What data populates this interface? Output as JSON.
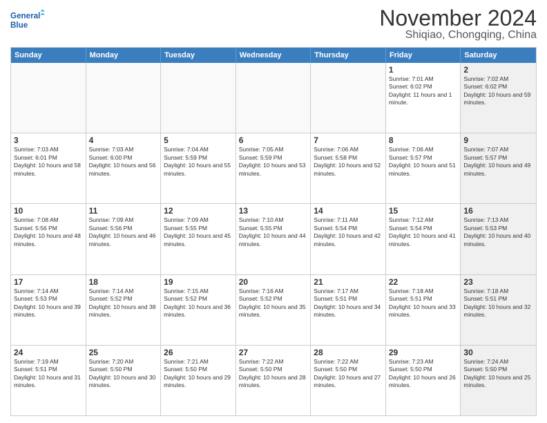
{
  "header": {
    "logo_line1": "General",
    "logo_line2": "Blue",
    "month": "November 2024",
    "location": "Shiqiao, Chongqing, China"
  },
  "days_of_week": [
    "Sunday",
    "Monday",
    "Tuesday",
    "Wednesday",
    "Thursday",
    "Friday",
    "Saturday"
  ],
  "weeks": [
    [
      {
        "day": "",
        "sunrise": "",
        "sunset": "",
        "daylight": "",
        "empty": true
      },
      {
        "day": "",
        "sunrise": "",
        "sunset": "",
        "daylight": "",
        "empty": true
      },
      {
        "day": "",
        "sunrise": "",
        "sunset": "",
        "daylight": "",
        "empty": true
      },
      {
        "day": "",
        "sunrise": "",
        "sunset": "",
        "daylight": "",
        "empty": true
      },
      {
        "day": "",
        "sunrise": "",
        "sunset": "",
        "daylight": "",
        "empty": true
      },
      {
        "day": "1",
        "sunrise": "Sunrise: 7:01 AM",
        "sunset": "Sunset: 6:02 PM",
        "daylight": "Daylight: 11 hours and 1 minute.",
        "empty": false
      },
      {
        "day": "2",
        "sunrise": "Sunrise: 7:02 AM",
        "sunset": "Sunset: 6:02 PM",
        "daylight": "Daylight: 10 hours and 59 minutes.",
        "empty": false,
        "saturday": true
      }
    ],
    [
      {
        "day": "3",
        "sunrise": "Sunrise: 7:03 AM",
        "sunset": "Sunset: 6:01 PM",
        "daylight": "Daylight: 10 hours and 58 minutes.",
        "empty": false
      },
      {
        "day": "4",
        "sunrise": "Sunrise: 7:03 AM",
        "sunset": "Sunset: 6:00 PM",
        "daylight": "Daylight: 10 hours and 56 minutes.",
        "empty": false
      },
      {
        "day": "5",
        "sunrise": "Sunrise: 7:04 AM",
        "sunset": "Sunset: 5:59 PM",
        "daylight": "Daylight: 10 hours and 55 minutes.",
        "empty": false
      },
      {
        "day": "6",
        "sunrise": "Sunrise: 7:05 AM",
        "sunset": "Sunset: 5:59 PM",
        "daylight": "Daylight: 10 hours and 53 minutes.",
        "empty": false
      },
      {
        "day": "7",
        "sunrise": "Sunrise: 7:06 AM",
        "sunset": "Sunset: 5:58 PM",
        "daylight": "Daylight: 10 hours and 52 minutes.",
        "empty": false
      },
      {
        "day": "8",
        "sunrise": "Sunrise: 7:06 AM",
        "sunset": "Sunset: 5:57 PM",
        "daylight": "Daylight: 10 hours and 51 minutes.",
        "empty": false
      },
      {
        "day": "9",
        "sunrise": "Sunrise: 7:07 AM",
        "sunset": "Sunset: 5:57 PM",
        "daylight": "Daylight: 10 hours and 49 minutes.",
        "empty": false,
        "saturday": true
      }
    ],
    [
      {
        "day": "10",
        "sunrise": "Sunrise: 7:08 AM",
        "sunset": "Sunset: 5:56 PM",
        "daylight": "Daylight: 10 hours and 48 minutes.",
        "empty": false
      },
      {
        "day": "11",
        "sunrise": "Sunrise: 7:09 AM",
        "sunset": "Sunset: 5:56 PM",
        "daylight": "Daylight: 10 hours and 46 minutes.",
        "empty": false
      },
      {
        "day": "12",
        "sunrise": "Sunrise: 7:09 AM",
        "sunset": "Sunset: 5:55 PM",
        "daylight": "Daylight: 10 hours and 45 minutes.",
        "empty": false
      },
      {
        "day": "13",
        "sunrise": "Sunrise: 7:10 AM",
        "sunset": "Sunset: 5:55 PM",
        "daylight": "Daylight: 10 hours and 44 minutes.",
        "empty": false
      },
      {
        "day": "14",
        "sunrise": "Sunrise: 7:11 AM",
        "sunset": "Sunset: 5:54 PM",
        "daylight": "Daylight: 10 hours and 42 minutes.",
        "empty": false
      },
      {
        "day": "15",
        "sunrise": "Sunrise: 7:12 AM",
        "sunset": "Sunset: 5:54 PM",
        "daylight": "Daylight: 10 hours and 41 minutes.",
        "empty": false
      },
      {
        "day": "16",
        "sunrise": "Sunrise: 7:13 AM",
        "sunset": "Sunset: 5:53 PM",
        "daylight": "Daylight: 10 hours and 40 minutes.",
        "empty": false,
        "saturday": true
      }
    ],
    [
      {
        "day": "17",
        "sunrise": "Sunrise: 7:14 AM",
        "sunset": "Sunset: 5:53 PM",
        "daylight": "Daylight: 10 hours and 39 minutes.",
        "empty": false
      },
      {
        "day": "18",
        "sunrise": "Sunrise: 7:14 AM",
        "sunset": "Sunset: 5:52 PM",
        "daylight": "Daylight: 10 hours and 38 minutes.",
        "empty": false
      },
      {
        "day": "19",
        "sunrise": "Sunrise: 7:15 AM",
        "sunset": "Sunset: 5:52 PM",
        "daylight": "Daylight: 10 hours and 36 minutes.",
        "empty": false
      },
      {
        "day": "20",
        "sunrise": "Sunrise: 7:16 AM",
        "sunset": "Sunset: 5:52 PM",
        "daylight": "Daylight: 10 hours and 35 minutes.",
        "empty": false
      },
      {
        "day": "21",
        "sunrise": "Sunrise: 7:17 AM",
        "sunset": "Sunset: 5:51 PM",
        "daylight": "Daylight: 10 hours and 34 minutes.",
        "empty": false
      },
      {
        "day": "22",
        "sunrise": "Sunrise: 7:18 AM",
        "sunset": "Sunset: 5:51 PM",
        "daylight": "Daylight: 10 hours and 33 minutes.",
        "empty": false
      },
      {
        "day": "23",
        "sunrise": "Sunrise: 7:18 AM",
        "sunset": "Sunset: 5:51 PM",
        "daylight": "Daylight: 10 hours and 32 minutes.",
        "empty": false,
        "saturday": true
      }
    ],
    [
      {
        "day": "24",
        "sunrise": "Sunrise: 7:19 AM",
        "sunset": "Sunset: 5:51 PM",
        "daylight": "Daylight: 10 hours and 31 minutes.",
        "empty": false
      },
      {
        "day": "25",
        "sunrise": "Sunrise: 7:20 AM",
        "sunset": "Sunset: 5:50 PM",
        "daylight": "Daylight: 10 hours and 30 minutes.",
        "empty": false
      },
      {
        "day": "26",
        "sunrise": "Sunrise: 7:21 AM",
        "sunset": "Sunset: 5:50 PM",
        "daylight": "Daylight: 10 hours and 29 minutes.",
        "empty": false
      },
      {
        "day": "27",
        "sunrise": "Sunrise: 7:22 AM",
        "sunset": "Sunset: 5:50 PM",
        "daylight": "Daylight: 10 hours and 28 minutes.",
        "empty": false
      },
      {
        "day": "28",
        "sunrise": "Sunrise: 7:22 AM",
        "sunset": "Sunset: 5:50 PM",
        "daylight": "Daylight: 10 hours and 27 minutes.",
        "empty": false
      },
      {
        "day": "29",
        "sunrise": "Sunrise: 7:23 AM",
        "sunset": "Sunset: 5:50 PM",
        "daylight": "Daylight: 10 hours and 26 minutes.",
        "empty": false
      },
      {
        "day": "30",
        "sunrise": "Sunrise: 7:24 AM",
        "sunset": "Sunset: 5:50 PM",
        "daylight": "Daylight: 10 hours and 25 minutes.",
        "empty": false,
        "saturday": true
      }
    ]
  ]
}
